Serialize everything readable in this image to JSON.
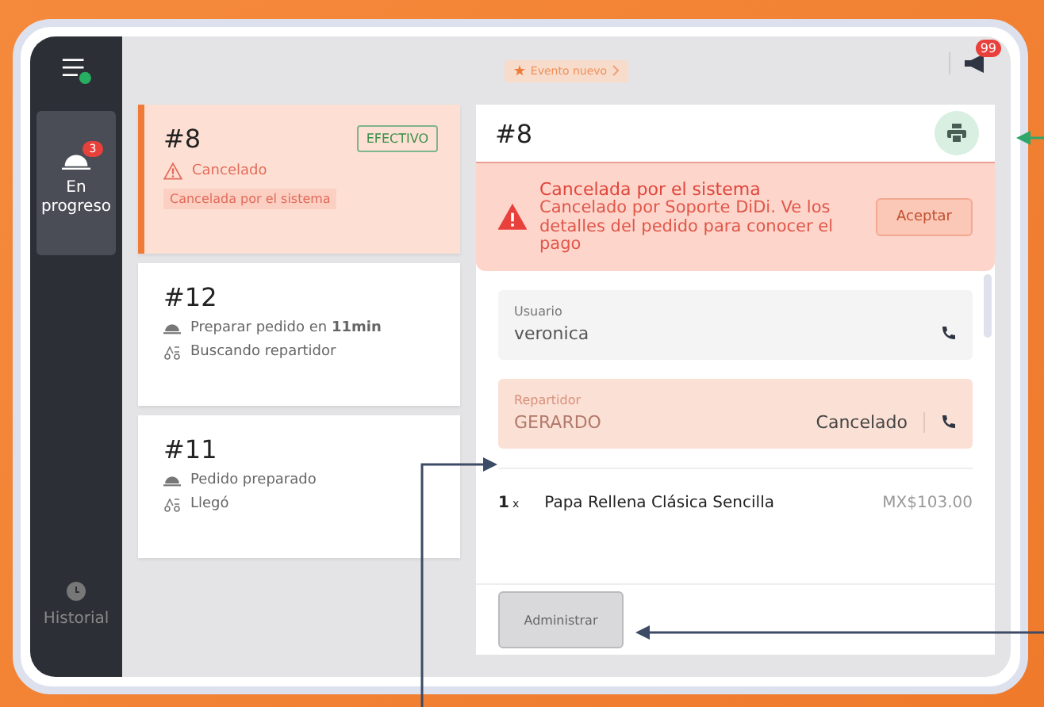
{
  "sidebar": {
    "menu_status": {
      "color": "#27ae60"
    },
    "items": [
      {
        "kind": "progress",
        "label": "En progreso",
        "badge": "3",
        "selected": true
      },
      {
        "kind": "history",
        "label": "Historial",
        "selected": false
      }
    ]
  },
  "topbar": {
    "event_chip": "Evento nuevo",
    "notifications": "99"
  },
  "orders": [
    {
      "number": "#8",
      "selected": true,
      "payment": "EFECTIVO",
      "lines": [
        {
          "kind": "warning",
          "text": "Cancelado"
        }
      ],
      "tag": "Cancelada por el sistema"
    },
    {
      "number": "#12",
      "selected": false,
      "lines": [
        {
          "kind": "prep",
          "text": "Preparar pedido en **11min**"
        },
        {
          "kind": "courier",
          "text": "Buscando repartidor"
        }
      ]
    },
    {
      "number": "#11",
      "selected": false,
      "lines": [
        {
          "kind": "prep",
          "text": "Pedido preparado"
        },
        {
          "kind": "courier",
          "text": "Llegó"
        }
      ]
    }
  ],
  "detail": {
    "number": "#8",
    "alert": {
      "title": "Cancelada por el sistema",
      "message": "Cancelado por Soporte DiDi. Ve los detalles del pedido para conocer el pago",
      "button": "Aceptar"
    },
    "contacts": [
      {
        "kind": "user",
        "label": "Usuario",
        "name": "veronica"
      },
      {
        "kind": "courier",
        "label": "Repartidor",
        "name": "GERARDO",
        "status": "Cancelado"
      }
    ],
    "items": [
      {
        "qty": "1",
        "unit": "x",
        "name": "Papa Rellena Clásica Sencilla",
        "price": "MX$103.00"
      }
    ],
    "button": "Administrar"
  }
}
